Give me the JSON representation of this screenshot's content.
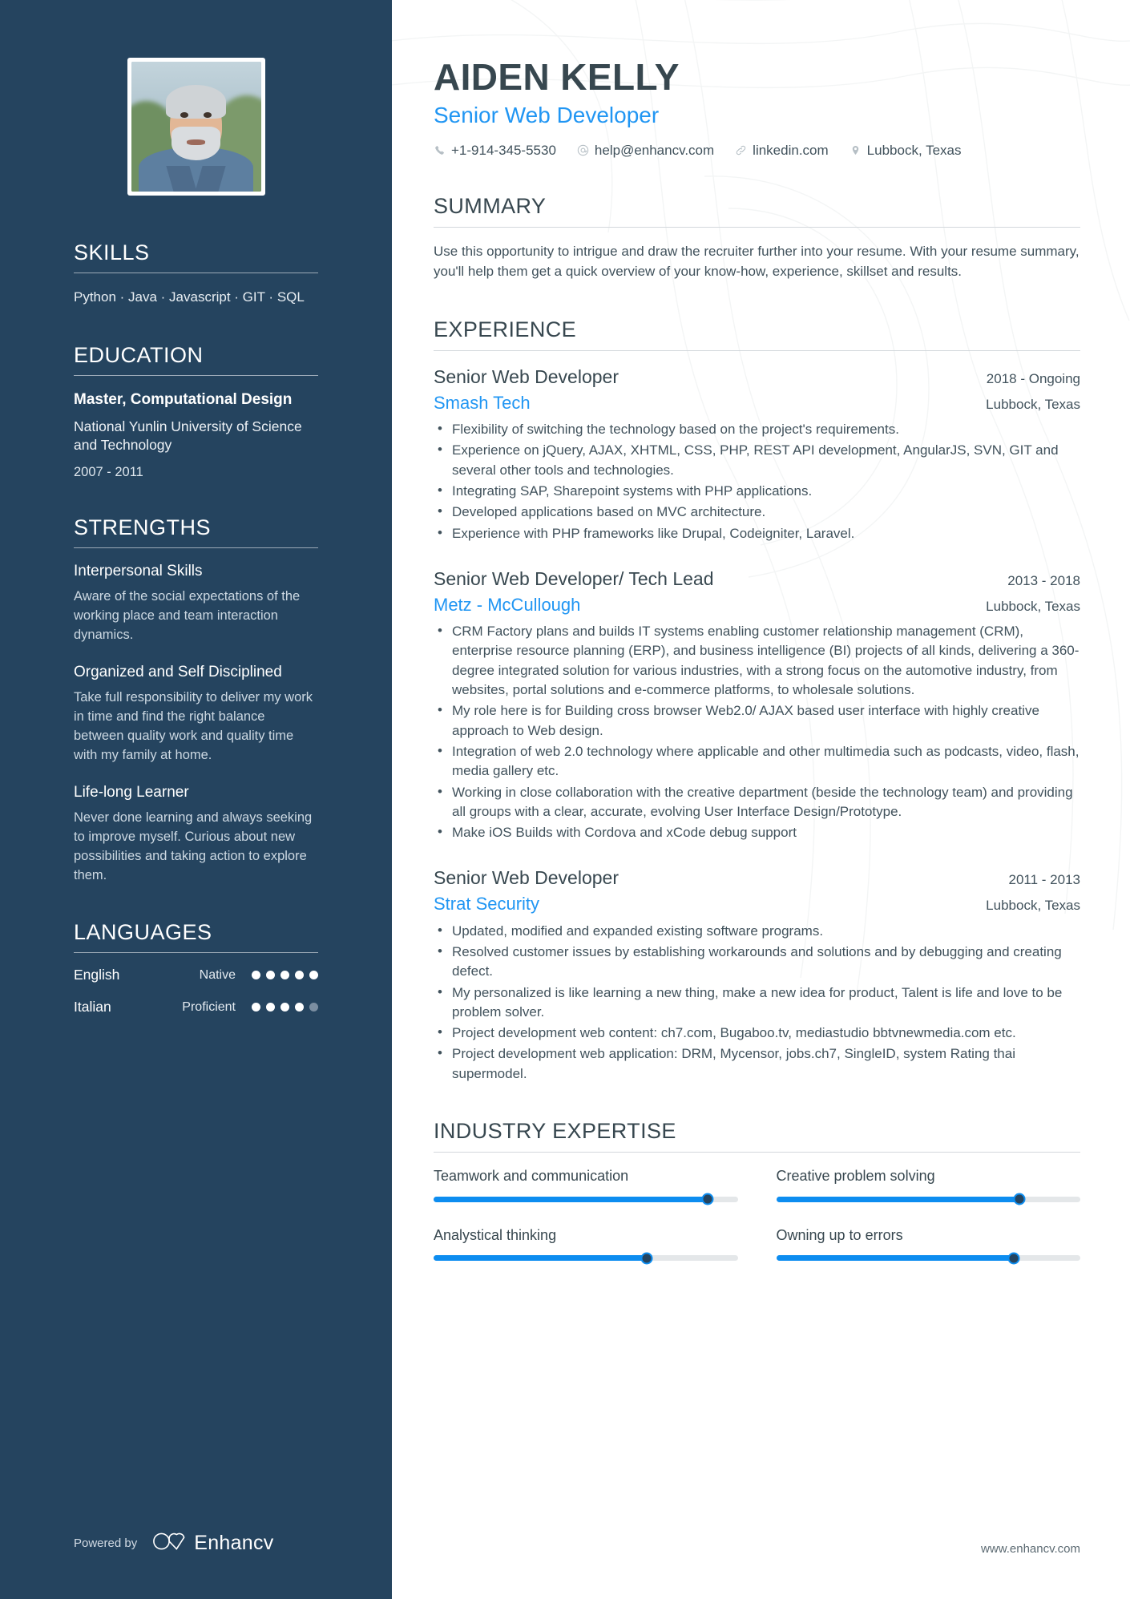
{
  "header": {
    "name": "AIDEN KELLY",
    "job_title": "Senior Web Developer",
    "contacts": [
      {
        "icon": "phone-icon",
        "value": "+1-914-345-5530"
      },
      {
        "icon": "email-icon",
        "value": "help@enhancv.com"
      },
      {
        "icon": "link-icon",
        "value": "linkedin.com"
      },
      {
        "icon": "location-pin-icon",
        "value": "Lubbock, Texas"
      }
    ]
  },
  "sidebar": {
    "skills": {
      "heading": "SKILLS",
      "list": "Python · Java · Javascript · GIT · SQL"
    },
    "education": {
      "heading": "EDUCATION",
      "degree": "Master, Computational Design",
      "school": "National Yunlin University of Science and Technology",
      "dates": "2007 - 2011"
    },
    "strengths": {
      "heading": "STRENGTHS",
      "items": [
        {
          "title": "Interpersonal Skills",
          "description": "Aware of the social expectations of the working place and team interaction dynamics."
        },
        {
          "title": "Organized and Self Disciplined",
          "description": "Take full responsibility to deliver my work in time and find the right balance between quality work and quality time with my family at home."
        },
        {
          "title": "Life-long Learner",
          "description": "Never done learning and always seeking to improve myself. Curious about new possibilities and taking action to explore them."
        }
      ]
    },
    "languages": {
      "heading": "LANGUAGES",
      "items": [
        {
          "name": "English",
          "level": "Native",
          "rating": 5,
          "max": 5
        },
        {
          "name": "Italian",
          "level": "Proficient",
          "rating": 4,
          "max": 5
        }
      ]
    },
    "footer": {
      "powered_by": "Powered by",
      "brand": "Enhancv",
      "logo_icon": "enhancv-infinity-heart-icon"
    }
  },
  "main": {
    "summary": {
      "heading": "SUMMARY",
      "text": "Use this opportunity to intrigue and draw the recruiter further into your resume. With your resume summary, you'll help them get a quick overview of your know-how, experience, skillset and results."
    },
    "experience": {
      "heading": "EXPERIENCE",
      "jobs": [
        {
          "role": "Senior Web Developer",
          "dates": "2018 - Ongoing",
          "company": "Smash Tech",
          "location": "Lubbock, Texas",
          "bullets": [
            "Flexibility of switching the technology based on the project's requirements.",
            "Experience on jQuery, AJAX, XHTML, CSS, PHP, REST API development, AngularJS, SVN, GIT and several other tools and technologies.",
            "Integrating SAP, Sharepoint systems with PHP applications.",
            "Developed applications based on MVC architecture.",
            "Experience with PHP frameworks like Drupal, Codeigniter, Laravel."
          ]
        },
        {
          "role": "Senior Web Developer/ Tech Lead",
          "dates": "2013 - 2018",
          "company": "Metz - McCullough",
          "location": "Lubbock, Texas",
          "bullets": [
            "CRM Factory plans and builds IT systems enabling customer relationship management (CRM), enterprise resource planning (ERP), and business intelligence (BI) projects of all kinds, delivering a 360-degree integrated solution for various industries, with a strong focus on the automotive industry, from websites, portal solutions and e-commerce platforms, to wholesale solutions.",
            "My role here is for Building cross browser Web2.0/ AJAX based user interface with highly creative approach to Web design.",
            "Integration of web 2.0 technology where applicable and other multimedia such as podcasts, video, flash, media gallery etc.",
            "Working in close collaboration with the creative department (beside the technology team) and providing all groups with a clear, accurate, evolving User Interface Design/Prototype.",
            "Make iOS Builds with Cordova and xCode debug support"
          ]
        },
        {
          "role": "Senior Web Developer",
          "dates": "2011 - 2013",
          "company": "Strat Security",
          "location": "Lubbock, Texas",
          "bullets": [
            "Updated, modified and expanded existing software programs.",
            "Resolved customer issues by establishing workarounds and solutions and by debugging and creating defect.",
            "My personalized is like learning a new thing, make a new idea for product, Talent is life and love to be problem solver.",
            "Project development web content: ch7.com, Bugaboo.tv, mediastudio bbtvnewmedia.com  etc.",
            "Project development web application: DRM, Mycensor, jobs.ch7, SingleID, system Rating thai supermodel."
          ]
        }
      ]
    },
    "industry_expertise": {
      "heading": "INDUSTRY EXPERTISE",
      "items": [
        {
          "label": "Teamwork and communication",
          "value": 90
        },
        {
          "label": "Creative problem solving",
          "value": 80
        },
        {
          "label": "Analystical thinking",
          "value": 70
        },
        {
          "label": "Owning up to errors",
          "value": 78
        }
      ]
    },
    "footer_url": "www.enhancv.com"
  },
  "colors": {
    "sidebar_bg": "#25445f",
    "accent_blue": "#2196f3",
    "slider_blue": "#0d8df0",
    "heading_text": "#37474f",
    "body_text": "#41525c"
  }
}
